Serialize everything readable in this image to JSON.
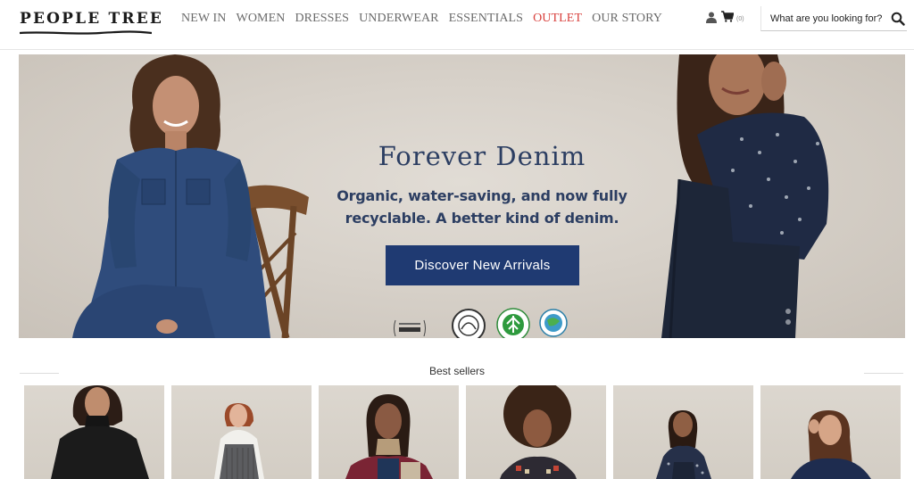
{
  "header": {
    "logo_text": "PEOPLE TREE",
    "nav": [
      {
        "label": "NEW IN"
      },
      {
        "label": "WOMEN"
      },
      {
        "label": "DRESSES"
      },
      {
        "label": "UNDERWEAR"
      },
      {
        "label": "ESSENTIALS"
      },
      {
        "label": "OUTLET",
        "color": "#d9423e"
      },
      {
        "label": "OUR STORY"
      }
    ],
    "cart_count": "(0)",
    "search_placeholder": "What are you looking for?",
    "icons": {
      "account": "user-icon",
      "cart": "cart-icon",
      "search": "search-icon"
    }
  },
  "hero": {
    "title": "Forever Denim",
    "subtitle_line1": "Organic, water-saving, and now fully",
    "subtitle_line2": "recyclable. A better kind of denim.",
    "cta_label": "Discover New Arrivals",
    "cta_color": "#1f3a72",
    "text_color": "#2c3e62",
    "certification_logos": [
      "vegan-logo",
      "soil-association-logo",
      "gots-logo",
      "wfto-logo"
    ]
  },
  "best_sellers": {
    "title": "Best sellers",
    "products": [
      {
        "image": "black-roll-neck-top"
      },
      {
        "image": "grey-pinafore-dress"
      },
      {
        "image": "patchwork-knit-jumper"
      },
      {
        "image": "fair-isle-cardigan"
      },
      {
        "image": "printed-shirt-dungarees"
      },
      {
        "image": "navy-knit-jumper"
      }
    ]
  }
}
